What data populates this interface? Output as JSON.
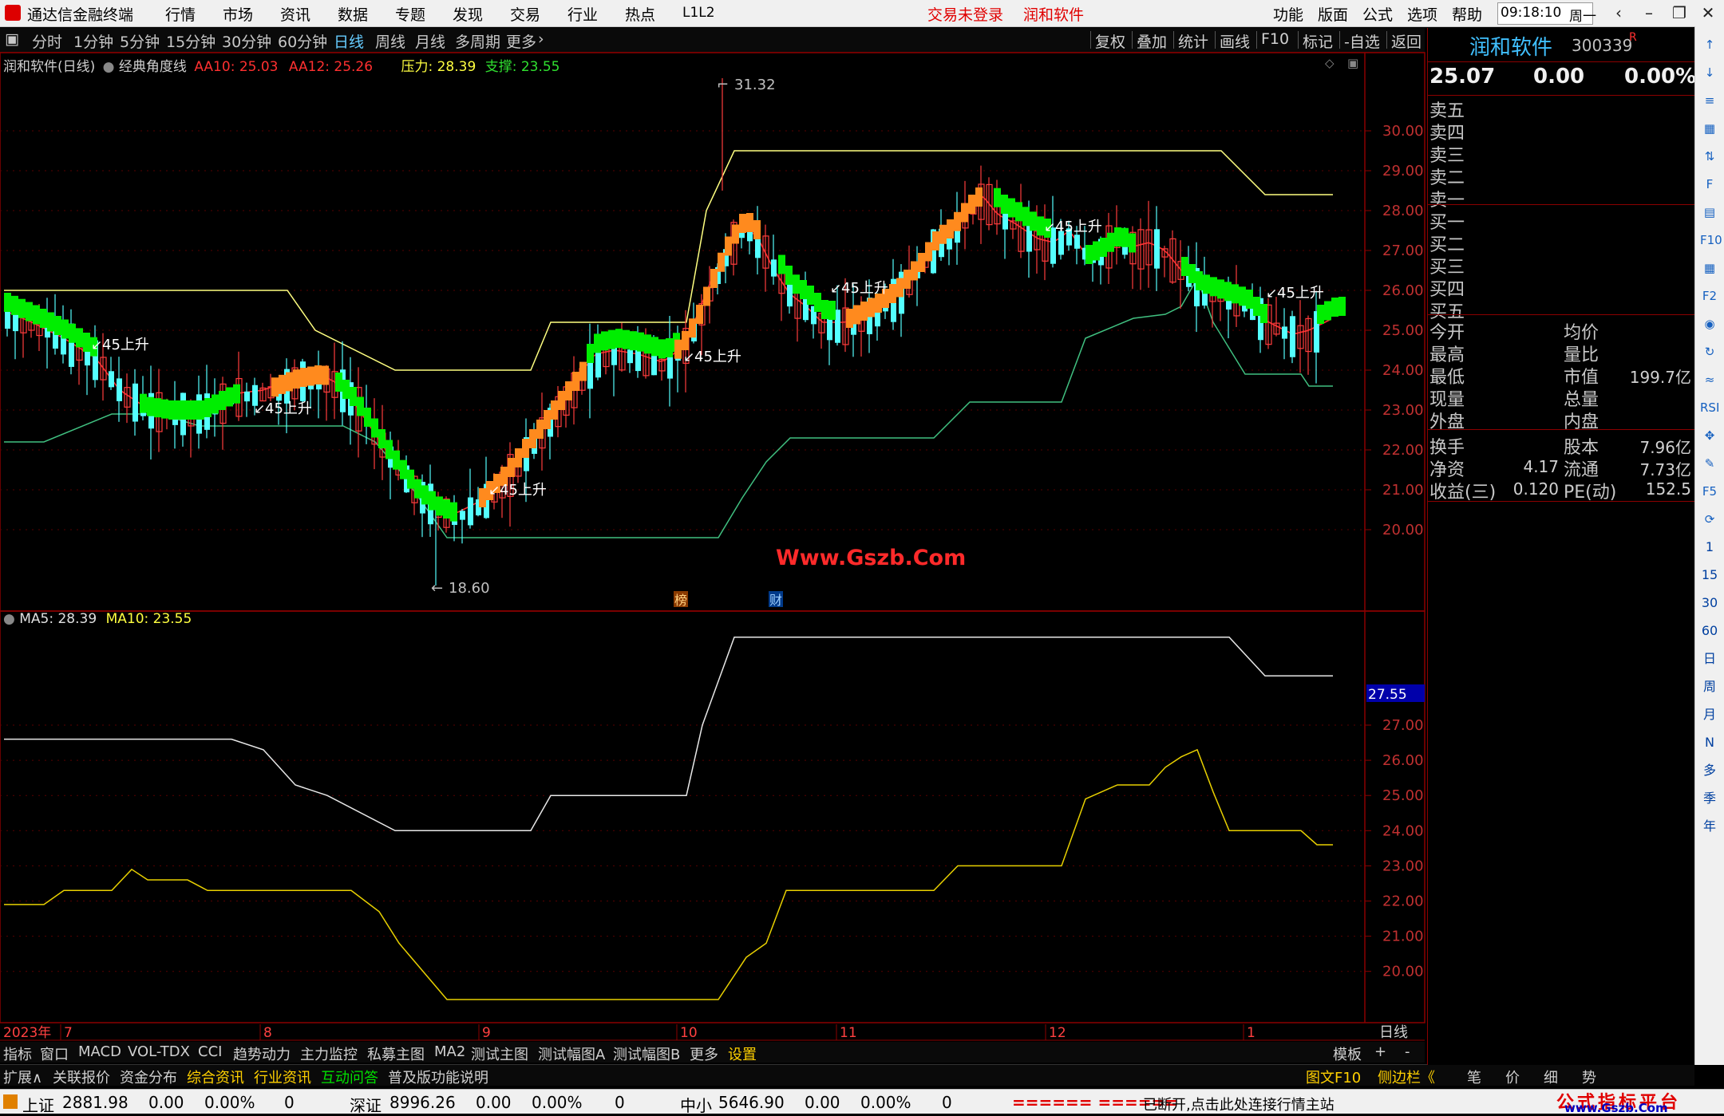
{
  "titlebar": {
    "app_name": "通达信金融终端",
    "menu": [
      "行情",
      "市场",
      "资讯",
      "数据",
      "专题",
      "发现",
      "交易",
      "行业",
      "热点",
      "L1L2"
    ],
    "login_status": "交易未登录",
    "broker": "润和软件",
    "right_menu": [
      "功能",
      "版面",
      "公式",
      "选项",
      "帮助"
    ],
    "time": "09:18:10",
    "weekday": "周一"
  },
  "period_bar": {
    "periods": [
      "分时",
      "1分钟",
      "5分钟",
      "15分钟",
      "30分钟",
      "60分钟",
      "日线",
      "周线",
      "月线",
      "多周期",
      "更多"
    ],
    "active_period": "日线",
    "tools": [
      "复权",
      "叠加",
      "统计",
      "画线",
      "F10",
      "标记",
      "-自选",
      "返回"
    ]
  },
  "main_chart": {
    "stock_title": "润和软件(日线)",
    "indicator_name": "经典角度线",
    "aa10_label": "AA10: 25.03",
    "aa12_label": "AA12: 25.26",
    "pressure_label": "压力: 28.39",
    "support_label": "支撑: 23.55",
    "high_label": "31.32",
    "low_label": "18.60",
    "watermark": "Www.Gszb.Com",
    "angle_labels": [
      "45上升",
      "45上升",
      "45上升",
      "45上升",
      "45上升",
      "45上升",
      "45上升"
    ],
    "marker_bang": "榜",
    "marker_cai": "财",
    "y_ticks": [
      "30.00",
      "29.00",
      "28.00",
      "27.00",
      "26.00",
      "25.00",
      "24.00",
      "23.00",
      "22.00",
      "21.00",
      "20.00"
    ]
  },
  "sub_chart": {
    "ma5_label": "MA5: 28.39",
    "ma10_label": "MA10: 23.55",
    "current_value_tag": "27.55",
    "y_ticks": [
      "27.00",
      "26.00",
      "25.00",
      "24.00",
      "23.00",
      "22.00",
      "21.00",
      "20.00"
    ]
  },
  "x_axis": {
    "year_label": "2023年",
    "months": [
      "7",
      "8",
      "9",
      "10",
      "11",
      "12",
      "1"
    ],
    "period_label": "日线"
  },
  "indicator_tabs": [
    "指标",
    "窗口",
    "MACD",
    "VOL-TDX",
    "CCI",
    "趋势动力",
    "主力监控",
    "私募主图",
    "MA2",
    "测试主图",
    "测试幅图A",
    "测试幅图B",
    "更多",
    "设置"
  ],
  "indicator_tabs_right": [
    "模板",
    "+",
    "-"
  ],
  "extension_tabs": [
    "扩展∧",
    "关联报价",
    "资金分布",
    "综合资讯",
    "行业资讯",
    "互动问答",
    "普及版功能说明"
  ],
  "extension_right": [
    "图文F10",
    "侧边栏《",
    "笔",
    "价",
    "细",
    "势"
  ],
  "quote_panel": {
    "name": "润和软件",
    "code": "300339",
    "flag": "R",
    "price": "25.07",
    "change": "0.00",
    "change_pct": "0.00%",
    "sell_levels": [
      "卖五",
      "卖四",
      "卖三",
      "卖二",
      "卖一"
    ],
    "buy_levels": [
      "买一",
      "买二",
      "买三",
      "买四",
      "买五"
    ],
    "stats_left": [
      "今开",
      "最高",
      "最低",
      "现量",
      "外盘"
    ],
    "stats_right": [
      "均价",
      "量比",
      "市值",
      "总量",
      "内盘"
    ],
    "market_cap": "199.7亿",
    "fund_rows": [
      {
        "l": "换手",
        "lv": "",
        "r": "股本",
        "rv": "7.96亿"
      },
      {
        "l": "净资",
        "lv": "4.17",
        "r": "流通",
        "rv": "7.73亿"
      },
      {
        "l": "收益(三)",
        "lv": "0.120",
        "r": "PE(动)",
        "rv": "152.5"
      }
    ]
  },
  "side_icons": [
    "↑",
    "↓",
    "≡",
    "▦",
    "⇅",
    "F",
    "▤",
    "F10",
    "▦",
    "F2",
    "◉",
    "↻",
    "≈",
    "RSI",
    "✥",
    "✎",
    "F5",
    "⟳",
    "1",
    "15",
    "30",
    "60",
    "日",
    "周",
    "月",
    "N",
    "多",
    "季",
    "年"
  ],
  "status_bar": {
    "indices": [
      {
        "name": "上证",
        "value": "2881.98",
        "chg": "0.00",
        "pct": "0.00%",
        "vol": "0"
      },
      {
        "name": "深证",
        "value": "8996.26",
        "chg": "0.00",
        "pct": "0.00%",
        "vol": "0"
      },
      {
        "name": "中小",
        "value": "5646.90",
        "chg": "0.00",
        "pct": "0.00%",
        "vol": "0"
      }
    ],
    "bars": "====== ======",
    "message": "已断开,点击此处连接行情主站",
    "brand_cn": "公式指标平台",
    "brand_url": "www.Gszb.Com"
  },
  "colors": {
    "up": "#ff3c3c",
    "down": "#54ffff",
    "orange": "#ff8a1e",
    "green": "#00ee00",
    "yellow": "#ffff55",
    "grid": "#8b0000"
  }
}
